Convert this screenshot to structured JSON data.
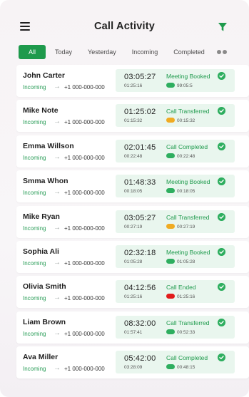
{
  "header": {
    "title": "Call Activity",
    "menu_icon": "hamburger-menu-icon",
    "filter_icon": "funnel-filter-icon"
  },
  "tabs": [
    {
      "label": "All",
      "active": true
    },
    {
      "label": "Today",
      "active": false
    },
    {
      "label": "Yesterday",
      "active": false
    },
    {
      "label": "Incoming",
      "active": false
    },
    {
      "label": "Completed",
      "active": false
    }
  ],
  "colors": {
    "accent": "#1e9a4c",
    "pill_green": "#2eae5f",
    "pill_orange": "#f0ab22",
    "pill_red": "#e21b1b"
  },
  "calls": [
    {
      "name": "John Carter",
      "direction": "Incoming",
      "phone": "+1 000-000-000",
      "duration": "03:05:27",
      "sub_time": "01:25:16",
      "status": "Meeting Booked",
      "pill_color": "#2eae5f",
      "pill_time": "99:05:5"
    },
    {
      "name": "Mike Note",
      "direction": "Incoming",
      "phone": "+1 000-000-000",
      "duration": "01:25:02",
      "sub_time": "01:15:32",
      "status": "Call Transferred",
      "pill_color": "#f0ab22",
      "pill_time": "00:15:32"
    },
    {
      "name": "Emma Willson",
      "direction": "Incoming",
      "phone": "+1 000-000-000",
      "duration": "02:01:45",
      "sub_time": "00:22:48",
      "status": "Call Completed",
      "pill_color": "#2eae5f",
      "pill_time": "00:22:48"
    },
    {
      "name": "Smma Whon",
      "direction": "Incoming",
      "phone": "+1 000-000-000",
      "duration": "01:48:33",
      "sub_time": "00:18:05",
      "status": "Meeting Booked",
      "pill_color": "#2eae5f",
      "pill_time": "00:18:05"
    },
    {
      "name": "Mike Ryan",
      "direction": "Incoming",
      "phone": "+1 000-000-000",
      "duration": "03:05:27",
      "sub_time": "00:27:19",
      "status": "Call Transferred",
      "pill_color": "#f0ab22",
      "pill_time": "00:27:19"
    },
    {
      "name": "Sophia Ali",
      "direction": "Incoming",
      "phone": "+1 000-000-000",
      "duration": "02:32:18",
      "sub_time": "01:05:28",
      "status": "Meeting Booked",
      "pill_color": "#2eae5f",
      "pill_time": "01:05:28"
    },
    {
      "name": "Olivia Smith",
      "direction": "Incoming",
      "phone": "+1 000-000-000",
      "duration": "04:12:56",
      "sub_time": "01:25:16",
      "status": "Call Ended",
      "pill_color": "#e21b1b",
      "pill_time": "01:25:16"
    },
    {
      "name": "Liam Brown",
      "direction": "Incoming",
      "phone": "+1 000-000-000",
      "duration": "08:32:00",
      "sub_time": "01:57:41",
      "status": "Call Transferred",
      "pill_color": "#2eae5f",
      "pill_time": "00:52:33"
    },
    {
      "name": "Ava Miller",
      "direction": "Incoming",
      "phone": "+1 000-000-000",
      "duration": "05:42:00",
      "sub_time": "03:28:09",
      "status": "Call Completed",
      "pill_color": "#2eae5f",
      "pill_time": "00:48:15"
    }
  ]
}
